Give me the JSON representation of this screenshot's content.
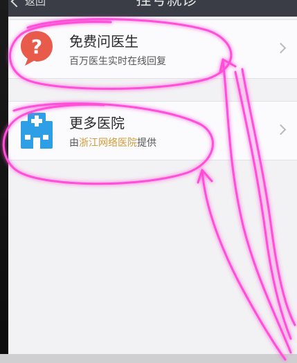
{
  "nav": {
    "back_label": "返回",
    "title": "挂号就诊"
  },
  "items": [
    {
      "title": "免费问医生",
      "subtitle": "百万医生实时在线回复",
      "icon": "question-bubble-icon"
    },
    {
      "title": "更多医院",
      "subtitle_prefix": "由",
      "subtitle_highlight": "浙江网络医院",
      "subtitle_suffix": "提供",
      "icon": "hospital-icon"
    }
  ],
  "colors": {
    "nav_bg": "#3a3d45",
    "screen_bg": "#f2f1f3",
    "icon_red": "#e85a4a",
    "icon_blue": "#2c9fe6",
    "highlight": "#d39a3a",
    "annotation": "#ff4fd8"
  }
}
